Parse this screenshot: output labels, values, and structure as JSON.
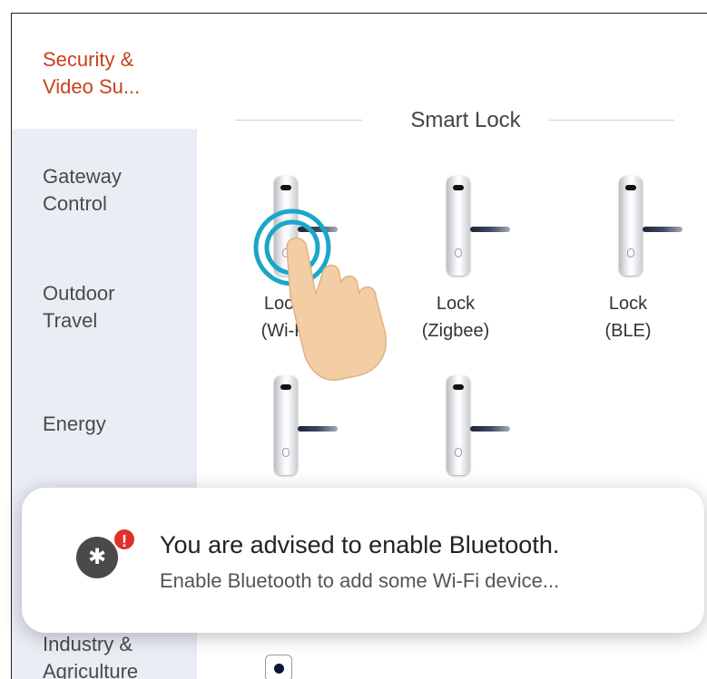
{
  "sidebar": {
    "items": [
      {
        "label": "Security &\nVideo Su...",
        "active": true
      },
      {
        "label": "Gateway\nControl"
      },
      {
        "label": "Outdoor\nTravel"
      },
      {
        "label": "Energy"
      },
      {
        "label": "Industry &\nAgriculture"
      }
    ]
  },
  "section": {
    "title": "Smart Lock"
  },
  "devices": [
    {
      "name": "Lock\n(Wi-F"
    },
    {
      "name": "Lock\n(Zigbee)"
    },
    {
      "name": "Lock\n(BLE)"
    },
    {
      "name": ""
    },
    {
      "name": ""
    }
  ],
  "toast": {
    "icon": "bluetooth-icon",
    "badge": "!",
    "title": "You are advised to enable Bluetooth.",
    "subtitle": "Enable Bluetooth to add some Wi-Fi device..."
  },
  "colors": {
    "active_category": "#c8411b",
    "sidebar_bg": "#e9edf4",
    "tap_ring": "#1aa6c8",
    "badge": "#e0302a"
  }
}
